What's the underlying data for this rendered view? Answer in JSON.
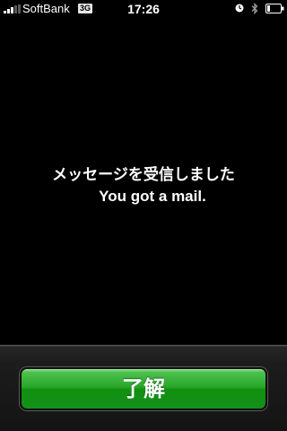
{
  "status_bar": {
    "carrier": "SoftBank",
    "network": "3G",
    "time": "17:26",
    "icons": [
      "signal-icon",
      "alarm-icon",
      "bluetooth-icon",
      "battery-icon"
    ]
  },
  "alert": {
    "message_jp": "メッセージを受信しました",
    "message_en": "You got a mail."
  },
  "buttons": {
    "ok_label": "了解"
  },
  "colors": {
    "background": "#000000",
    "button_green": "#2aa62a",
    "text": "#ffffff"
  }
}
